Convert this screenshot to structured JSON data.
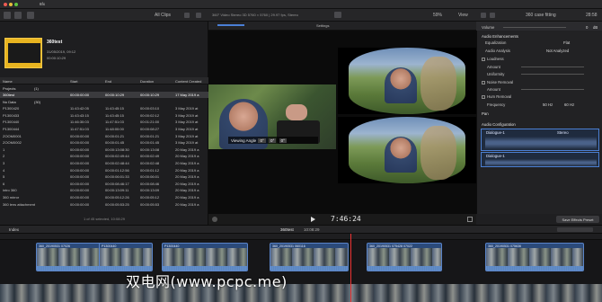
{
  "titlebar": {
    "window_menu": "6fx"
  },
  "toolbar": {
    "clip_filter": "All Clips",
    "clip_format": "360° Video Stereo 3D 5760 × 5760 | 29.97 fps, Stereo",
    "zoom": "59%",
    "view_label": "View",
    "inspector_title": "360 case fitting",
    "inspector_time": "28:58"
  },
  "browser": {
    "clip": {
      "name": "360test",
      "date": "31/05/2019, 09:12",
      "duration": "00:00:10:29"
    },
    "columns": [
      "Name",
      "Start",
      "End",
      "Duration",
      "Content Created"
    ],
    "rows": [
      {
        "kind": "group",
        "name": "Projects",
        "count": "(1)",
        "start": "",
        "end": "",
        "duration": "",
        "created": ""
      },
      {
        "kind": "sel",
        "name": "360test",
        "count": "",
        "start": "00:00:00:00",
        "end": "00:00:10:29",
        "duration": "00:00:10:29",
        "created": "17 May 2019 a"
      },
      {
        "kind": "group",
        "name": "No Data",
        "count": "(30)",
        "start": "",
        "end": "",
        "duration": "",
        "created": ""
      },
      {
        "kind": "row",
        "name": "P1300420",
        "count": "",
        "start": "11:43:42:05",
        "end": "11:43:45:15",
        "duration": "00:00:03:10",
        "created": "3 May 2019 at"
      },
      {
        "kind": "row",
        "name": "P1300433",
        "count": "",
        "start": "11:43:43:15",
        "end": "11:43:45:15",
        "duration": "00:00:02:12",
        "created": "3 May 2019 at"
      },
      {
        "kind": "row",
        "name": "P1300440",
        "count": "",
        "start": "11:46:30:03",
        "end": "11:47:51:03",
        "duration": "00:01:21:00",
        "created": "3 May 2019 at"
      },
      {
        "kind": "row",
        "name": "P1300444",
        "count": "",
        "start": "11:47:51:03",
        "end": "11:48:00:00",
        "duration": "00:00:08:27",
        "created": "3 May 2019 at"
      },
      {
        "kind": "row",
        "name": "ZOOM0001",
        "count": "",
        "start": "00:00:00:00",
        "end": "00:00:01:21",
        "duration": "00:00:01:21",
        "created": "3 May 2019 at"
      },
      {
        "kind": "row",
        "name": "ZOOM0002",
        "count": "",
        "start": "00:00:00:00",
        "end": "00:00:01:45",
        "duration": "00:00:01:45",
        "created": "3 May 2019 at"
      },
      {
        "kind": "row",
        "name": "1",
        "count": "",
        "start": "00:00:00:00",
        "end": "00:00:13:08:30",
        "duration": "00:00:13:08",
        "created": "20 May 2019 a"
      },
      {
        "kind": "row",
        "name": "2",
        "count": "",
        "start": "00:00:00:00",
        "end": "00:00:02:49:44",
        "duration": "00:00:02:49",
        "created": "20 May 2019 a"
      },
      {
        "kind": "row",
        "name": "3",
        "count": "",
        "start": "00:00:00:00",
        "end": "00:00:02:48:44",
        "duration": "00:00:02:48",
        "created": "20 May 2019 a"
      },
      {
        "kind": "row",
        "name": "4",
        "count": "",
        "start": "00:00:00:00",
        "end": "00:00:01:12:56",
        "duration": "00:00:01:12",
        "created": "20 May 2019 a"
      },
      {
        "kind": "row",
        "name": "5",
        "count": "",
        "start": "00:00:00:00",
        "end": "00:00:06:01:33",
        "duration": "00:00:06:01",
        "created": "20 May 2019 a"
      },
      {
        "kind": "row",
        "name": "6",
        "count": "",
        "start": "00:00:00:00",
        "end": "00:00:08:46:17",
        "duration": "00:00:08:46",
        "created": "20 May 2019 a"
      },
      {
        "kind": "row",
        "name": "intro 360",
        "count": "",
        "start": "00:00:00:00",
        "end": "00:00:13:09:11",
        "duration": "00:00:13:09",
        "created": "20 May 2019 a"
      },
      {
        "kind": "row",
        "name": "360 mirror",
        "count": "",
        "start": "00:00:00:00",
        "end": "00:00:05:12:26",
        "duration": "00:00:05:12",
        "created": "20 May 2019 a"
      },
      {
        "kind": "row",
        "name": "360 lens attachment",
        "count": "",
        "start": "00:00:00:00",
        "end": "00:00:05:53:25",
        "duration": "00:00:05:53",
        "created": "20 May 2019 a"
      }
    ],
    "footer": "1 of 45 selected, 10:08:29"
  },
  "viewer": {
    "settings_label": "Settings",
    "angle_label": "Viewing Angle",
    "angle_x": "0°",
    "angle_y": "0°",
    "angle_z": "0°",
    "timecode": "7:46:24"
  },
  "inspector": {
    "volume_label": "Volume",
    "volume_value": "0",
    "volume_unit": "dB",
    "enhancements": "Audio Enhancements",
    "equalization": "Equalization",
    "eq_value": "Flat",
    "audio_analysis": "Audio Analysis",
    "analysis_value": "Not Analyzed",
    "loudness": "Loudness",
    "amount": "Amount",
    "uniformity": "Uniformity",
    "noise_removal": "Noise Removal",
    "amount2": "Amount",
    "hum_removal": "Hum Removal",
    "frequency": "Frequency",
    "freq_50": "50 Hz",
    "freq_60": "60 Hz",
    "pan": "Pan",
    "audio_config": "Audio Configuration",
    "dialogue1": "Dialogue-1",
    "stereo": "Stereo",
    "dialogue2": "Dialogue-1",
    "save_preset": "Save Effects Preset"
  },
  "timeline": {
    "index": "Index",
    "project": "360test",
    "duration": "10:08:29",
    "clips": [
      {
        "label": "360_20190531 07026"
      },
      {
        "label": "P1300440"
      },
      {
        "label": "P1300440"
      },
      {
        "label": "360_20190531 060116"
      },
      {
        "label": "360_20190531 075428 07022"
      },
      {
        "label": "360_20190531 075636"
      }
    ]
  },
  "watermark": "双电网(www.pcpc.me)"
}
